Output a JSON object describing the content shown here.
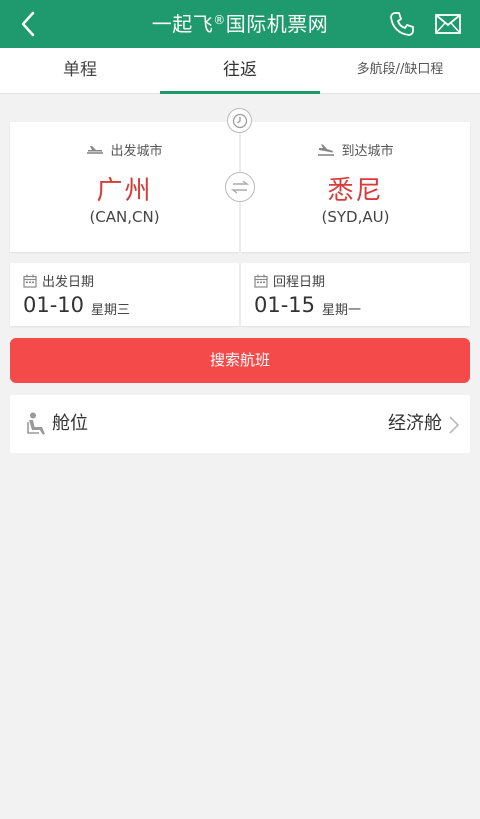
{
  "header": {
    "title": "一起飞",
    "registered_mark": "®",
    "title_suffix": "国际机票网",
    "back_icon": "back-arrow-icon",
    "phone_icon": "phone-icon",
    "mail_icon": "mail-icon",
    "color": "#1f9a6f"
  },
  "tabs": [
    {
      "label": "单程",
      "active": false
    },
    {
      "label": "往返",
      "active": true
    },
    {
      "label": "多航段//缺口程",
      "active": false
    }
  ],
  "departure": {
    "label": "出发城市",
    "city": "广州",
    "code": "(CAN,CN)"
  },
  "arrival": {
    "label": "到达城市",
    "city": "悉尼",
    "code": "(SYD,AU)"
  },
  "depart_date": {
    "label": "出发日期",
    "date": "01-10",
    "weekday": "星期三"
  },
  "return_date": {
    "label": "回程日期",
    "date": "01-15",
    "weekday": "星期一"
  },
  "search": {
    "label": "搜索航班",
    "color": "#f44a4a"
  },
  "cabin": {
    "label": "舱位",
    "value": "经济舱"
  }
}
